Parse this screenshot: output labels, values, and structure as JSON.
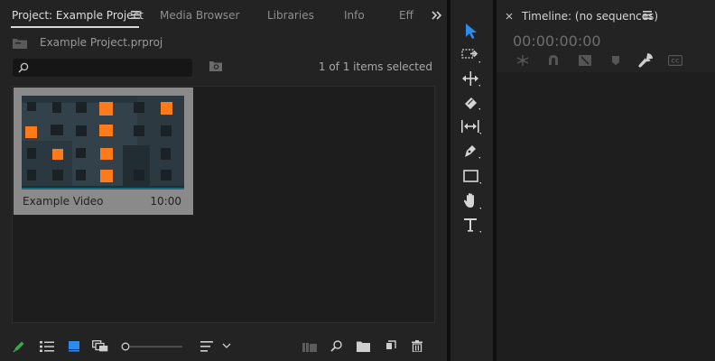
{
  "project_panel": {
    "tabs": [
      {
        "label": "Project: Example Project",
        "active": true
      },
      {
        "label": "Media Browser"
      },
      {
        "label": "Libraries"
      },
      {
        "label": "Info"
      },
      {
        "label": "Eff"
      }
    ],
    "project_file": "Example Project.prproj",
    "search": {
      "value": "",
      "placeholder": ""
    },
    "selection_status": "1 of 1 items selected",
    "clip": {
      "name": "Example Video",
      "duration": "10:00"
    }
  },
  "timeline": {
    "title": "Timeline: (no sequences)",
    "timecode": "00:00:00:00"
  },
  "colors": {
    "accent_blue": "#2d8ceb",
    "pencil_green": "#3ba84a",
    "window_orange": "#ff7a1a"
  }
}
